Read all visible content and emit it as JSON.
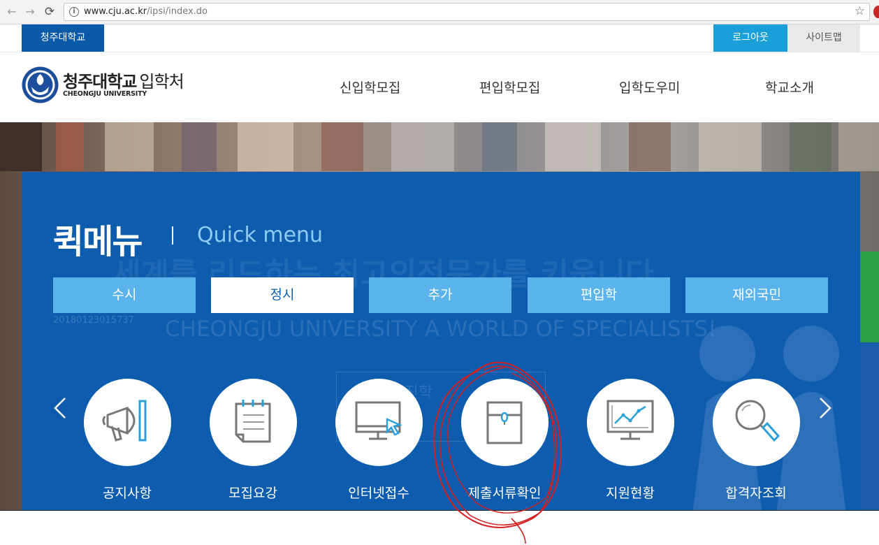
{
  "browser": {
    "url_host": "www.cju.ac.kr",
    "url_path": "/ipsi/index.do",
    "back_icon": "←",
    "forward_icon": "→",
    "reload_icon": "⟳",
    "star_icon": "☆",
    "info_icon": "i"
  },
  "utilbar": {
    "university_tab": "청주대학교",
    "logout": "로그아웃",
    "sitemap": "사이트맵"
  },
  "header": {
    "logo_main": "청주대학교",
    "logo_sub": "입학처",
    "logo_en": "CHEONGJU UNIVERSITY",
    "nav": [
      "신입학모집",
      "편입학모집",
      "입학도우미",
      "학교소개"
    ]
  },
  "quick_menu": {
    "title": "퀵메뉴",
    "subtitle": "Quick menu",
    "tabs": [
      "수시",
      "정시",
      "추가",
      "편입학",
      "재외국민"
    ],
    "active_tab": "정시",
    "items": [
      {
        "label": "공지사항",
        "icon": "megaphone-icon"
      },
      {
        "label": "모집요강",
        "icon": "notepad-icon"
      },
      {
        "label": "인터넷접수",
        "icon": "monitor-cursor-icon"
      },
      {
        "label": "제출서류확인",
        "icon": "document-envelope-icon"
      },
      {
        "label": "지원현황",
        "icon": "chart-monitor-icon"
      },
      {
        "label": "합격자조회",
        "icon": "magnifier-icon"
      }
    ],
    "prev_icon": "‹",
    "next_icon": "›"
  },
  "watermark": {
    "slogan_kr": "세계를 리드하는 최고의전문가를 키웁니다",
    "slogan_en": "CHEONGJU UNIVERSITY A WORLD OF SPECIALISTS!",
    "number": "20180123015737",
    "box_text": "학년 진학"
  },
  "colors": {
    "brand_blue": "#0d5cae",
    "tab_blue": "#5bb3ec",
    "logout_blue": "#1a9fd8",
    "icon_blue": "#2a9fd8",
    "annotation_red": "#d42020"
  }
}
